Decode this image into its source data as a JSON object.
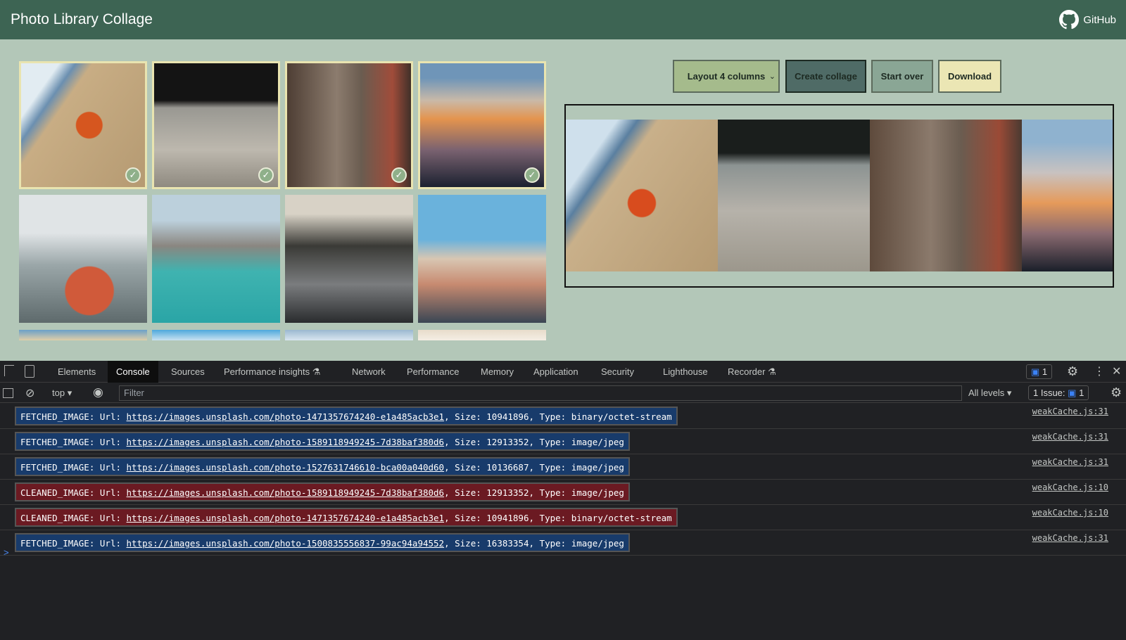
{
  "header": {
    "title": "Photo Library Collage",
    "github_label": "GitHub",
    "github_icon": "github-icon"
  },
  "gallery": {
    "photos": [
      {
        "subject": "starfish",
        "selected": true
      },
      {
        "subject": "bicycle",
        "selected": true
      },
      {
        "subject": "alley",
        "selected": true
      },
      {
        "subject": "clouds-wing",
        "selected": true
      },
      {
        "subject": "hiker",
        "selected": false
      },
      {
        "subject": "lake",
        "selected": false
      },
      {
        "subject": "bridge",
        "selected": false
      },
      {
        "subject": "venice",
        "selected": false
      }
    ]
  },
  "controls": {
    "layout_select": "Layout 4 columns",
    "create": "Create collage",
    "start_over": "Start over",
    "download": "Download"
  },
  "colors": {
    "header": "#3d6453",
    "background": "#b3c7b8",
    "fetched": "#183b6b",
    "cleaned": "#6b1a22"
  },
  "devtools": {
    "tabs": [
      "Elements",
      "Console",
      "Sources",
      "Performance insights",
      "Network",
      "Performance",
      "Memory",
      "Application",
      "Security",
      "Lighthouse",
      "Recorder"
    ],
    "active_tab": "Console",
    "messages_badge": "1",
    "context": "top",
    "filter_placeholder": "Filter",
    "levels": "All levels",
    "issues_label": "1 Issue:",
    "issues_count": "1",
    "logs": [
      {
        "type": "FETCHED_IMAGE",
        "url": "https://images.unsplash.com/photo-1471357674240-e1a485acb3e1",
        "rest": ", Size: 10941896, Type: binary/octet-stream",
        "source": "weakCache.js:31"
      },
      {
        "type": "FETCHED_IMAGE",
        "url": "https://images.unsplash.com/photo-1589118949245-7d38baf380d6",
        "rest": ", Size: 12913352, Type: image/jpeg",
        "source": "weakCache.js:31"
      },
      {
        "type": "FETCHED_IMAGE",
        "url": "https://images.unsplash.com/photo-1527631746610-bca00a040d60",
        "rest": ", Size: 10136687, Type: image/jpeg",
        "source": "weakCache.js:31"
      },
      {
        "type": "CLEANED_IMAGE",
        "url": "https://images.unsplash.com/photo-1589118949245-7d38baf380d6",
        "rest": ", Size: 12913352, Type: image/jpeg",
        "source": "weakCache.js:10"
      },
      {
        "type": "CLEANED_IMAGE",
        "url": "https://images.unsplash.com/photo-1471357674240-e1a485acb3e1",
        "rest": ", Size: 10941896, Type: binary/octet-stream",
        "source": "weakCache.js:10"
      },
      {
        "type": "FETCHED_IMAGE",
        "url": "https://images.unsplash.com/photo-1500835556837-99ac94a94552",
        "rest": ", Size: 16383354, Type: image/jpeg",
        "source": "weakCache.js:31"
      }
    ],
    "prompt": ">"
  }
}
